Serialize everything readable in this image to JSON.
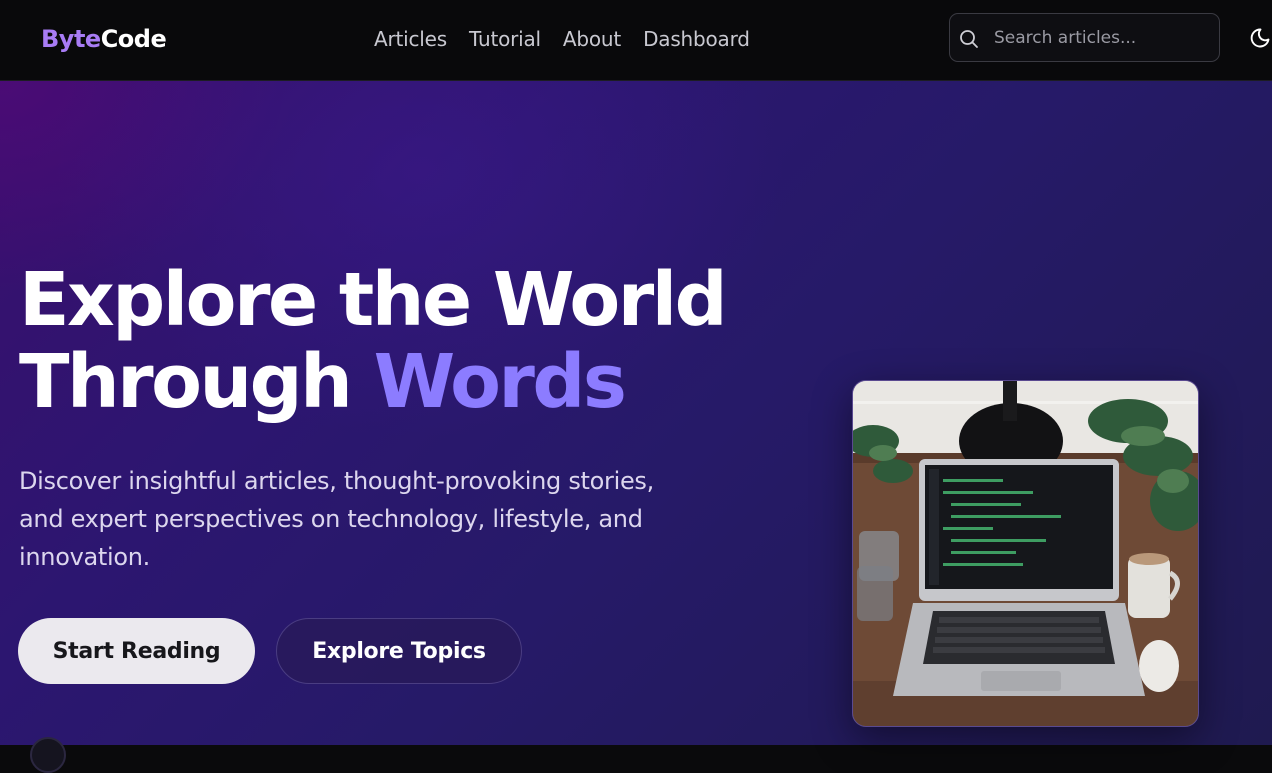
{
  "header": {
    "logo_part1": "Byte",
    "logo_part2": "Code",
    "nav": [
      {
        "label": "Articles"
      },
      {
        "label": "Tutorial"
      },
      {
        "label": "About"
      },
      {
        "label": "Dashboard"
      }
    ],
    "search": {
      "placeholder": "Search articles...",
      "value": ""
    }
  },
  "hero": {
    "headline_line1": "Explore the World",
    "headline_line2_plain": "Through",
    "headline_line2_accent": "Words",
    "subtitle": "Discover insightful articles, thought-provoking stories, and expert perspectives on technology, lifestyle, and innovation.",
    "primary_button": "Start Reading",
    "secondary_button": "Explore Topics"
  },
  "icons": {
    "search": "search-icon",
    "theme": "moon-icon"
  },
  "colors": {
    "brand_accent": "#a87cf5",
    "headline_accent": "#8c7cff",
    "header_bg": "#09090b"
  }
}
